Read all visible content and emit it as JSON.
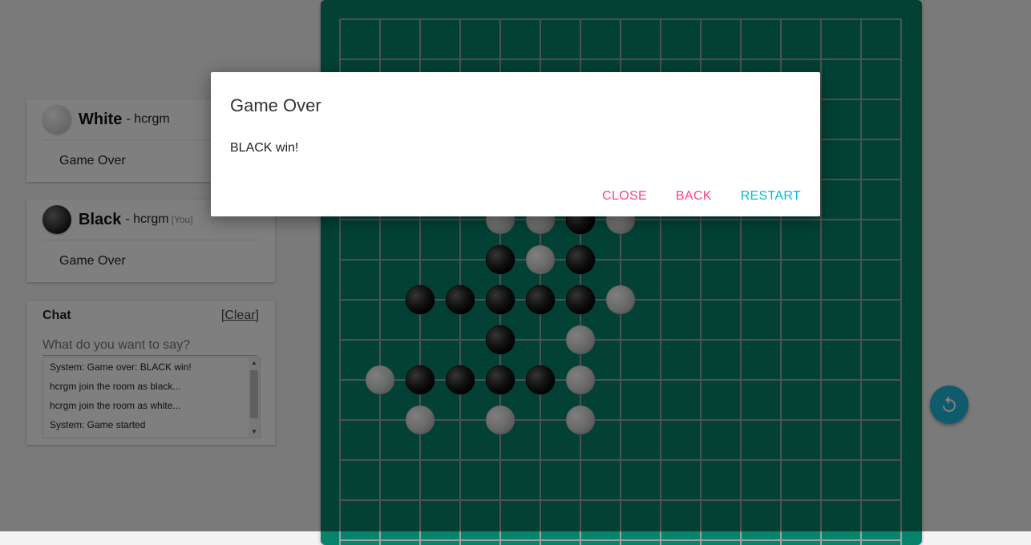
{
  "players": {
    "white": {
      "name": "White",
      "user": "- hcrgm",
      "you": "",
      "status": "Game Over"
    },
    "black": {
      "name": "Black",
      "user": "- hcrgm",
      "you": "[You]",
      "status": "Game Over"
    }
  },
  "chat": {
    "title": "Chat",
    "clear_label": "[Clear]",
    "placeholder": "What do you want to say?",
    "messages": [
      "System: Game over: BLACK win!",
      "hcrgm join the room as black...",
      "hcrgm join the room as white...",
      "System: Game started"
    ]
  },
  "board": {
    "stones": [
      {
        "c": 4,
        "r": 5,
        "color": "white"
      },
      {
        "c": 5,
        "r": 5,
        "color": "white"
      },
      {
        "c": 6,
        "r": 5,
        "color": "black"
      },
      {
        "c": 7,
        "r": 5,
        "color": "white"
      },
      {
        "c": 4,
        "r": 6,
        "color": "black"
      },
      {
        "c": 5,
        "r": 6,
        "color": "white"
      },
      {
        "c": 6,
        "r": 6,
        "color": "black"
      },
      {
        "c": 2,
        "r": 7,
        "color": "black"
      },
      {
        "c": 3,
        "r": 7,
        "color": "black"
      },
      {
        "c": 4,
        "r": 7,
        "color": "black"
      },
      {
        "c": 5,
        "r": 7,
        "color": "black"
      },
      {
        "c": 6,
        "r": 7,
        "color": "black"
      },
      {
        "c": 7,
        "r": 7,
        "color": "white"
      },
      {
        "c": 4,
        "r": 8,
        "color": "black"
      },
      {
        "c": 6,
        "r": 8,
        "color": "white"
      },
      {
        "c": 1,
        "r": 9,
        "color": "white"
      },
      {
        "c": 2,
        "r": 9,
        "color": "black"
      },
      {
        "c": 3,
        "r": 9,
        "color": "black"
      },
      {
        "c": 4,
        "r": 9,
        "color": "black"
      },
      {
        "c": 5,
        "r": 9,
        "color": "black"
      },
      {
        "c": 6,
        "r": 9,
        "color": "white"
      },
      {
        "c": 2,
        "r": 10,
        "color": "white"
      },
      {
        "c": 4,
        "r": 10,
        "color": "white"
      },
      {
        "c": 6,
        "r": 10,
        "color": "white"
      }
    ]
  },
  "fab": {
    "icon": "undo-icon"
  },
  "dialog": {
    "title": "Game Over",
    "body": "BLACK win!",
    "close_label": "CLOSE",
    "back_label": "BACK",
    "restart_label": "RESTART"
  },
  "colors": {
    "board": "#07836b",
    "grid": "#9aa3a0",
    "accent_pink": "#ff4081",
    "accent_cyan": "#00bcd4",
    "fab": "#1fb6d8"
  }
}
